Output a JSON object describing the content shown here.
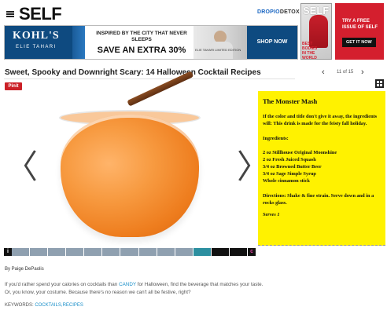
{
  "header": {
    "logo": "SELF",
    "dropbox_a": "DROPIO",
    "dropbox_b": "DETOX"
  },
  "magazine": {
    "cover_logo": "SELF",
    "cover_text": "BEST BODIES IN THE WORLD",
    "promo_text": "TRY A FREE ISSUE OF SELF",
    "promo_button": "GET IT NOW"
  },
  "ad": {
    "brand": "KOHL'S",
    "sub_brand": "ELIE TAHARI",
    "tagline": "INSPIRED BY THE CITY THAT NEVER SLEEPS",
    "offer": "SAVE AN EXTRA 30%",
    "model_label": "ELIE TAHARI LIMITED EDITION",
    "cta": "SHOP NOW"
  },
  "gallery": {
    "title": "Sweet, Spooky and Downright Scary: 14 Halloween Cocktail Recipes",
    "counter": "11 of 15",
    "pinit": "Pinit",
    "prev": "‹",
    "next": "›",
    "stage_prev": "〈",
    "stage_next": "〉",
    "info_label": "i",
    "cc_label": "c"
  },
  "recipe": {
    "name": "The Monster Mash",
    "intro": "If the color and title don't give it away, the ingredients will: This drink is made for the feisty fall holiday.",
    "ingredients_heading": "Ingredients:",
    "ingredients": [
      "2 oz Stillhouse Original Moonshine",
      "2 oz Fresh Juiced Squash",
      "3/4 oz Browned Butter Beer",
      "3/4 oz Sage Simple Syrup",
      "Whole cinnamon stick"
    ],
    "directions": "Directions: Shake & fine strain. Serve down and in a rocks glass.",
    "serves": "Serves 1"
  },
  "article": {
    "byline": "By Paige DePaolis",
    "body_before": "If you'd rather spend your calories on cocktails than ",
    "body_link": "CANDY",
    "body_after": " for Halloween, find the beverage that matches your taste. Or, you know, your costume. Because there's no reason we can't all be festive, right?",
    "keywords_label": "KEYWORDS: ",
    "keywords_links": "COCKTAILS,RECIPES"
  },
  "colors": {
    "recipe_bg": "#fff200",
    "pinit": "#cb2027",
    "link": "#1a8fc9",
    "ad_blue": "#0e4a80",
    "promo_red": "#d41f2e"
  },
  "icons": [
    "hamburger-icon",
    "grid-icon",
    "chevron-left-icon",
    "chevron-right-icon",
    "info-icon"
  ]
}
